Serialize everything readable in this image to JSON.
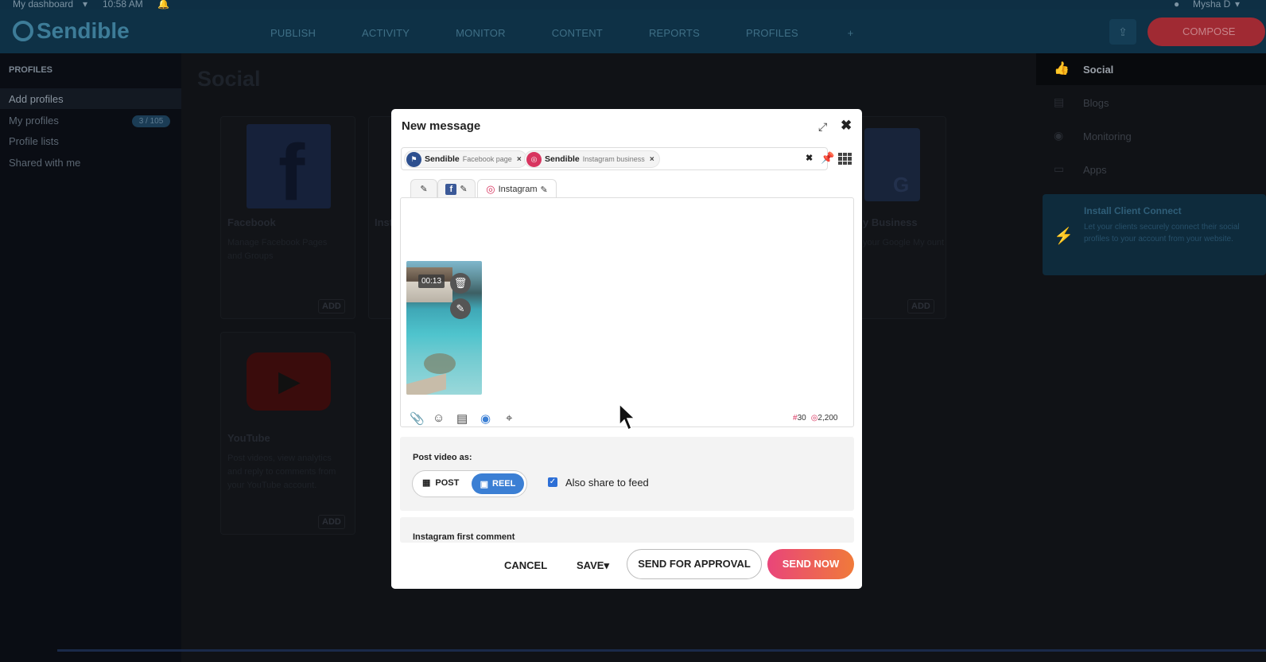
{
  "topstrip": {
    "dashboard": "My dashboard",
    "time": "10:58 AM",
    "user": "Mysha D"
  },
  "navbar": {
    "logo": "Sendible",
    "links": [
      "PUBLISH",
      "ACTIVITY",
      "MONITOR",
      "CONTENT",
      "REPORTS",
      "PROFILES"
    ],
    "compose": "COMPOSE"
  },
  "sidebar": {
    "header": "PROFILES",
    "items": [
      "Add profiles",
      "My profiles",
      "Profile lists",
      "Shared with me"
    ],
    "badge": "3 / 105"
  },
  "main": {
    "title": "Social",
    "cards": [
      {
        "title": "Facebook",
        "desc": "Manage Facebook Pages and Groups",
        "add": "ADD"
      },
      {
        "title": "Inst",
        "desc": "",
        "add": ""
      },
      {
        "title": "y Business",
        "desc": "your Google My ount",
        "add": "ADD"
      },
      {
        "title": "YouTube",
        "desc": "Post videos, view analytics and reply to comments from your YouTube account.",
        "add": "ADD"
      }
    ]
  },
  "rightpanel": {
    "items": [
      "Social",
      "Blogs",
      "Monitoring",
      "Apps"
    ],
    "connect_title": "Install Client Connect",
    "connect_desc": "Let your clients securely connect their social profiles to your account from your website."
  },
  "modal": {
    "title": "New message",
    "profiles": [
      {
        "name": "Sendible",
        "type": "Facebook page",
        "color": "#2d4f8f"
      },
      {
        "name": "Sendible",
        "type": "Instagram business",
        "color": "#d8345f"
      }
    ],
    "tabs": {
      "instagram_label": "Instagram"
    },
    "video_time": "00:13",
    "hashtag_count": "30",
    "char_count": "2,200",
    "post_video_as": "Post video as:",
    "post_label": "POST",
    "reel_label": "REEL",
    "also_share": "Also share to feed",
    "also_share_checked": true,
    "first_comment_label": "Instagram first comment",
    "cancel": "CANCEL",
    "save": "SAVE",
    "send_approval": "SEND FOR APPROVAL",
    "send_now": "SEND NOW"
  }
}
